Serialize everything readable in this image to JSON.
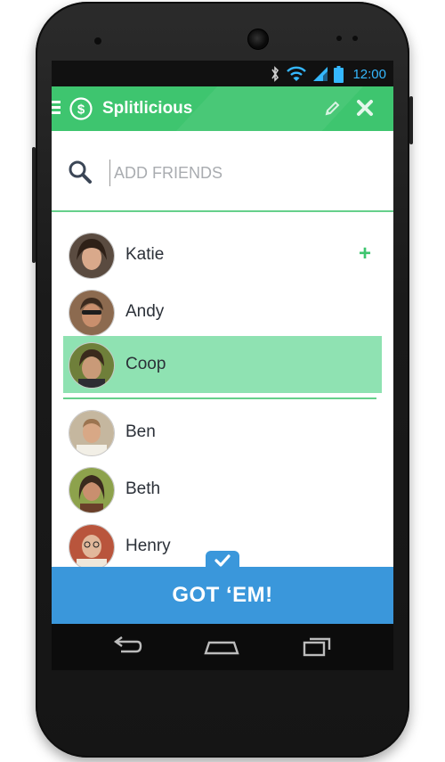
{
  "status_bar": {
    "time": "12:00"
  },
  "app_bar": {
    "title": "Splitlicious"
  },
  "search": {
    "placeholder": "ADD FRIENDS"
  },
  "friends": [
    {
      "name": "Katie",
      "action": "+"
    },
    {
      "name": "Andy"
    },
    {
      "name": "Coop",
      "selected": true
    },
    {
      "name": "Ben"
    },
    {
      "name": "Beth"
    },
    {
      "name": "Henry"
    }
  ],
  "confirm": {
    "label": "GOT ‘EM!"
  },
  "colors": {
    "primary_green": "#3ec56f",
    "selected_row": "#8fe2b2",
    "confirm_blue": "#3a97db",
    "time_blue": "#35b8ff"
  }
}
